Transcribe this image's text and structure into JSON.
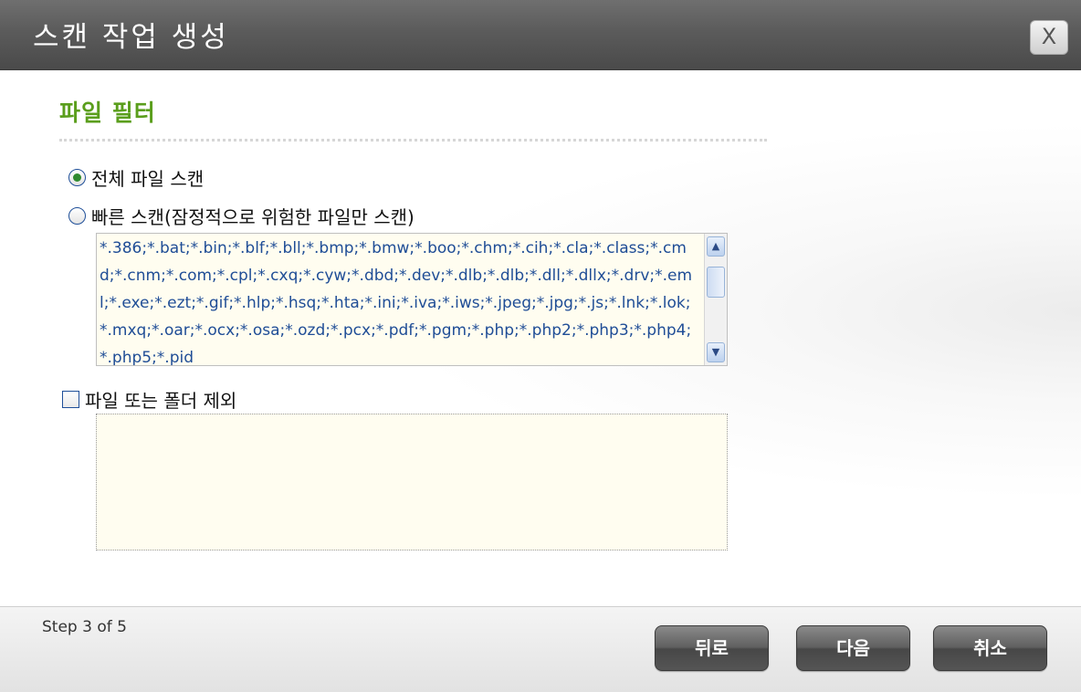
{
  "dialog": {
    "title": "스캔 작업 생성",
    "close_label": "X"
  },
  "section": {
    "title": "파일 필터"
  },
  "options": {
    "full_scan": {
      "label": "전체 파일 스캔",
      "checked": true
    },
    "quick_scan": {
      "label": "빠른 스캔(잠정적으로 위험한 파일만 스캔)",
      "checked": false
    },
    "extensions": "*.386;*.bat;*.bin;*.blf;*.bll;*.bmp;*.bmw;*.boo;*.chm;*.cih;*.cla;*.class;*.cmd;*.cnm;*.com;*.cpl;*.cxq;*.cyw;*.dbd;*.dev;*.dlb;*.dlb;*.dll;*.dllx;*.drv;*.eml;*.exe;*.ezt;*.gif;*.hlp;*.hsq;*.hta;*.ini;*.iva;*.iws;*.jpeg;*.jpg;*.js;*.lnk;*.lok;*.mxq;*.oar;*.ocx;*.osa;*.ozd;*.pcx;*.pdf;*.pgm;*.php;*.php2;*.php3;*.php4;*.php5;*.pid",
    "exclude": {
      "label": "파일 또는 폴더 제외",
      "checked": false,
      "value": ""
    }
  },
  "footer": {
    "step": "Step 3 of 5",
    "back_label": "뒤로",
    "next_label": "다음",
    "cancel_label": "취소"
  },
  "icons": {
    "scroll_up": "scroll-up-arrow-icon",
    "scroll_down": "scroll-down-arrow-icon",
    "close": "close-icon"
  },
  "colors": {
    "section_title": "#5a9e1c",
    "extension_text": "#1f4d96",
    "box_background": "#fffdf0"
  }
}
